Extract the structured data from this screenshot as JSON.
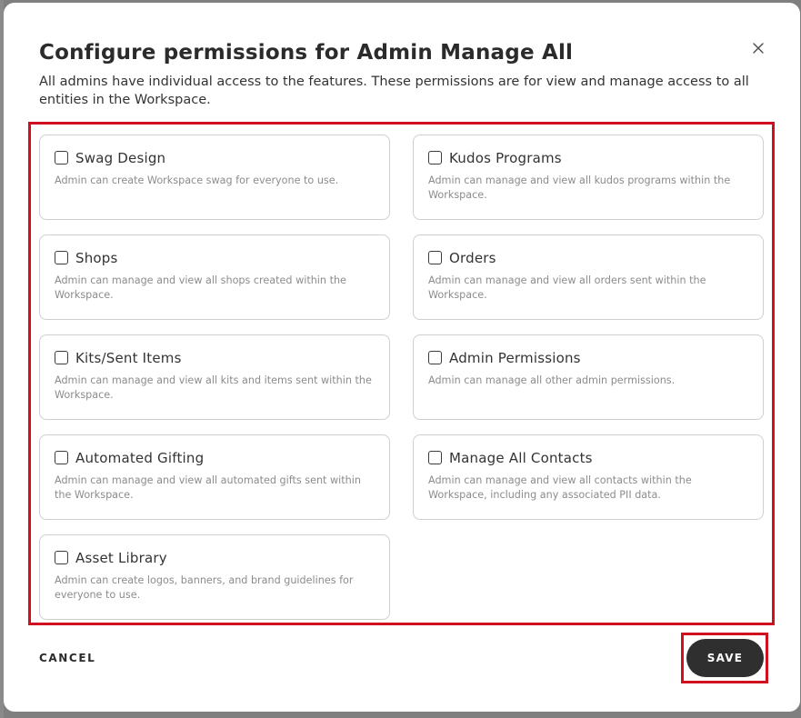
{
  "dialog": {
    "title": "Configure permissions for Admin Manage All",
    "subtitle": "All admins have individual access to the features. These permissions are for view and manage access to all entities in the Workspace.",
    "close_icon": "close-icon"
  },
  "permissions": [
    {
      "label": "Swag Design",
      "description": "Admin can create Workspace swag for everyone to use.",
      "checked": false
    },
    {
      "label": "Kudos Programs",
      "description": "Admin can manage and view all kudos programs within the Workspace.",
      "checked": false
    },
    {
      "label": "Shops",
      "description": "Admin can manage and view all shops created within the Workspace.",
      "checked": false
    },
    {
      "label": "Orders",
      "description": "Admin can manage and view all orders sent within the Workspace.",
      "checked": false
    },
    {
      "label": "Kits/Sent Items",
      "description": "Admin can manage and view all kits and items sent within the Workspace.",
      "checked": false
    },
    {
      "label": "Admin Permissions",
      "description": "Admin can manage all other admin permissions.",
      "checked": false
    },
    {
      "label": "Automated Gifting",
      "description": "Admin can manage and view all automated gifts sent within the Workspace.",
      "checked": false
    },
    {
      "label": "Manage All Contacts",
      "description": "Admin can manage and view all contacts within the Workspace, including any associated PII data.",
      "checked": false
    },
    {
      "label": "Asset Library",
      "description": "Admin can create logos, banners, and brand guidelines for everyone to use.",
      "checked": false
    }
  ],
  "footer": {
    "cancel_label": "CANCEL",
    "save_label": "SAVE"
  },
  "colors": {
    "highlight": "#d0101e",
    "primary_button": "#2f2f2f",
    "card_border": "#cfcfcf",
    "overlay": "#7f7f7f"
  }
}
